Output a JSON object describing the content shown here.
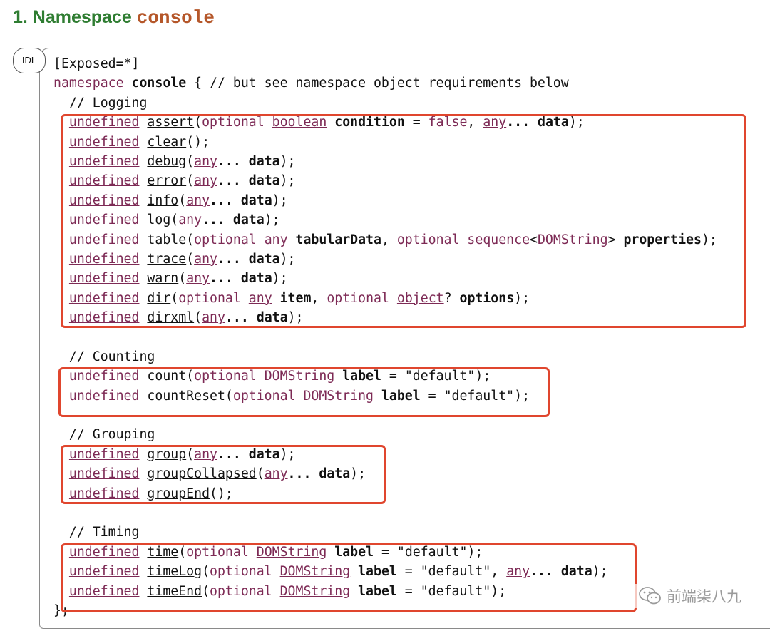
{
  "heading": {
    "number": "1. Namespace ",
    "code": "console"
  },
  "idl_tab": "IDL",
  "code": {
    "exposed": "[Exposed=*]",
    "ns_kw": "namespace",
    "ns_name": "console",
    "ns_rest": " { // but see namespace object requirements below",
    "comment_logging": "// Logging",
    "comment_counting": "// Counting",
    "comment_grouping": "// Grouping",
    "comment_timing": "// Timing",
    "close": "};",
    "tokens": {
      "undefined": "undefined",
      "optional": "optional",
      "boolean": "boolean",
      "any": "any",
      "false": "false",
      "sequence": "sequence",
      "DOMString": "DOMString",
      "object": "object",
      "ellipsis": "...",
      "data": "data",
      "condition": "condition",
      "tabularData": "tabularData",
      "properties": "properties",
      "item": "item",
      "options": "options",
      "label": "label",
      "default_str": "\"default\""
    },
    "fns": {
      "assert": "assert",
      "clear": "clear",
      "debug": "debug",
      "error": "error",
      "info": "info",
      "log": "log",
      "table": "table",
      "trace": "trace",
      "warn": "warn",
      "dir": "dir",
      "dirxml": "dirxml",
      "count": "count",
      "countReset": "countReset",
      "group": "group",
      "groupCollapsed": "groupCollapsed",
      "groupEnd": "groupEnd",
      "time": "time",
      "timeLog": "timeLog",
      "timeEnd": "timeEnd"
    }
  },
  "watermark": {
    "text": "前端柒八九",
    "icon": "wechat-icon"
  },
  "colors": {
    "heading": "#2f7d32",
    "code_accent": "#b5572a",
    "keyword": "#7d2a55",
    "highlight_box": "#e0462e"
  }
}
